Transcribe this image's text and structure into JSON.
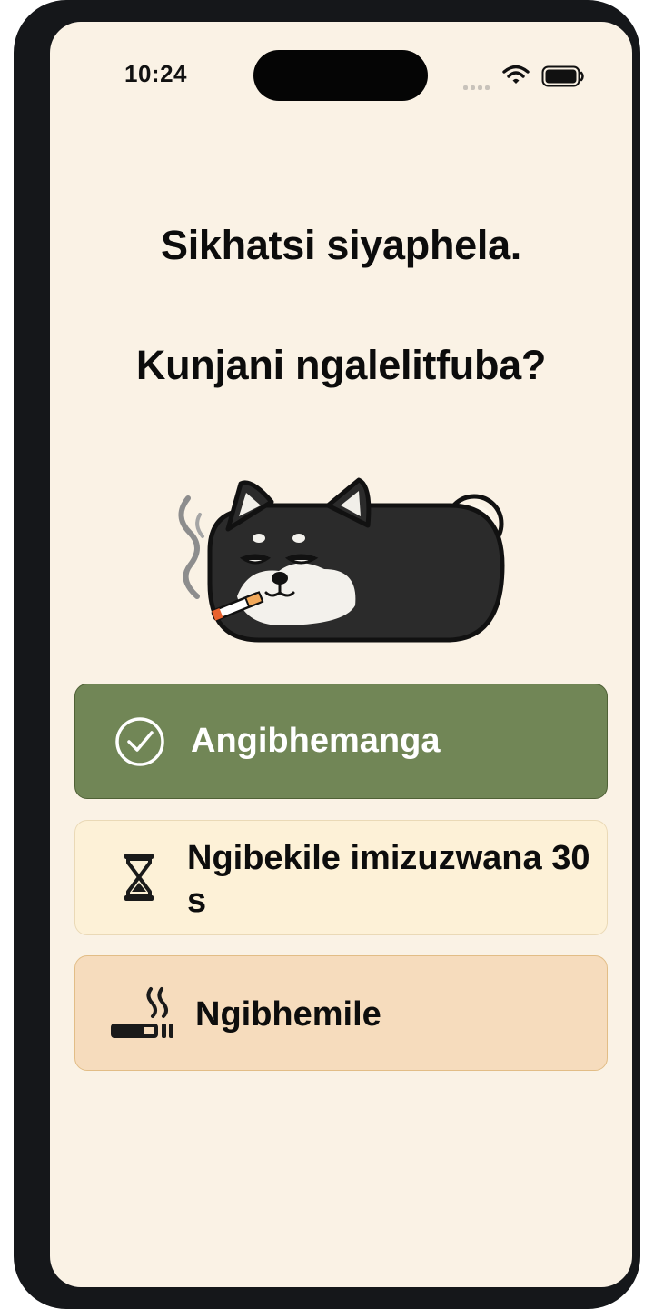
{
  "status_bar": {
    "time": "10:24",
    "wifi_icon": "wifi-icon",
    "battery_icon": "battery-icon",
    "signal_icon": "cellular-signal-icon"
  },
  "prompt": {
    "line1": "Sikhatsi siyaphela.",
    "line2": "Kunjani ngalelitfuba?"
  },
  "mascot": {
    "icon": "smoking-dog-mascot"
  },
  "options": [
    {
      "icon": "check-circle-icon",
      "label": "Angibhemanga"
    },
    {
      "icon": "hourglass-icon",
      "label": "Ngibekile imizuzwana 30\ns"
    },
    {
      "icon": "cigarette-smoke-icon",
      "label": "Ngibhemile"
    }
  ],
  "colors": {
    "background": "#faf2e5",
    "option_green": "#718656",
    "option_cream": "#fdf1d7",
    "option_peach": "#f6dcbd"
  }
}
